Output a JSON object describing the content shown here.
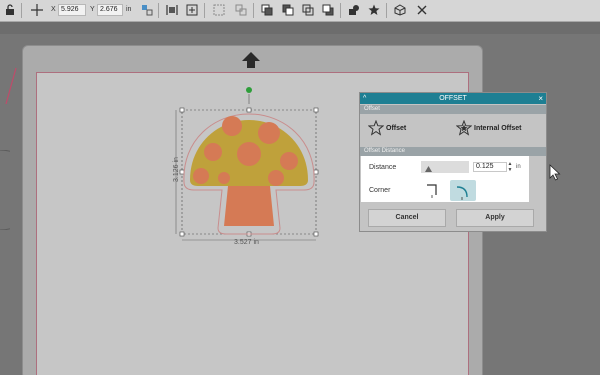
{
  "toolbar": {
    "x_label": "X",
    "x_value": "5.926",
    "y_label": "Y",
    "y_value": "2.676",
    "unit": "in"
  },
  "design": {
    "width_dimension": "3.527 in",
    "height_dimension": "3.126 in",
    "colors": {
      "cap": "#bfa13b",
      "spots": "#d57a55",
      "stem": "#d57a55",
      "selection_handle": "#2e9e3a"
    }
  },
  "offset_panel": {
    "title": "OFFSET",
    "collapse_glyph": "^",
    "close_glyph": "×",
    "section_offset": "Offset",
    "offset_button": "Offset",
    "internal_offset_button": "Internal Offset",
    "section_distance": "Offset Distance",
    "distance_label": "Distance",
    "distance_value": "0.125",
    "distance_unit": "in",
    "corner_label": "Corner",
    "corner_options": [
      "sharp",
      "round"
    ],
    "corner_selected": "round",
    "cancel_button": "Cancel",
    "apply_button": "Apply",
    "title_color": "#1e7f93"
  }
}
